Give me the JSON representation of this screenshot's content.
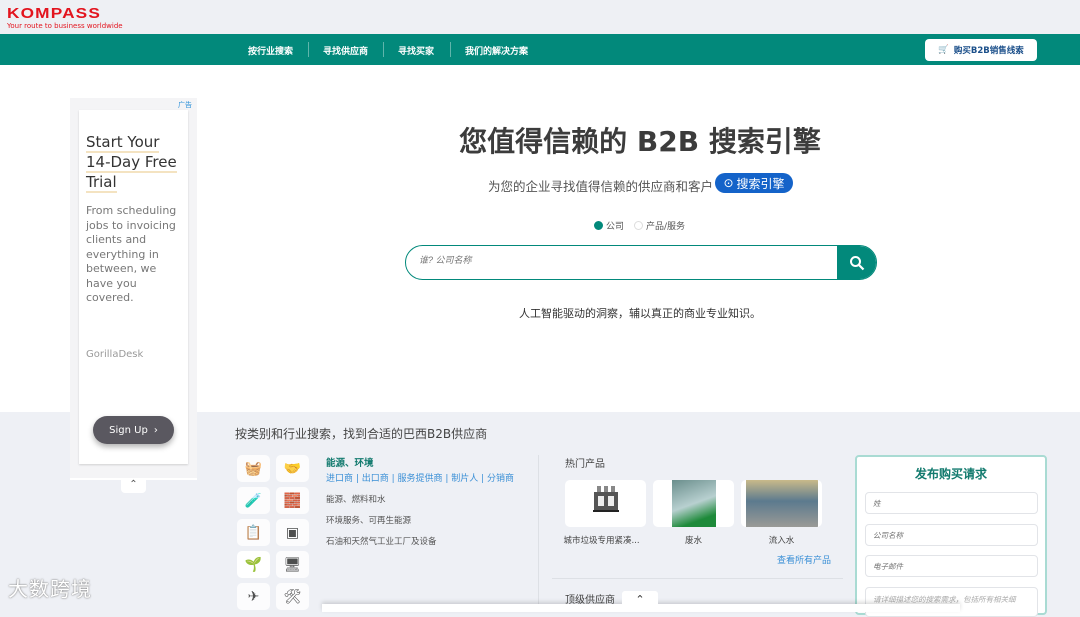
{
  "header": {
    "logo": "KOMPASS",
    "tagline": "Your route to business worldwide",
    "nav": [
      "按行业搜索",
      "寻找供应商",
      "寻找买家",
      "我们的解决方案"
    ],
    "buy_button": "购买B2B销售线索"
  },
  "hero": {
    "title": "您值得信赖的 B2B 搜索引擎",
    "subtitle": "为您的企业寻找值得信赖的供应商和客户",
    "pill": "搜索引擎",
    "radio_company": "公司",
    "radio_product": "产品/服务",
    "search_placeholder": "谁? 公司名称",
    "tagline": "人工智能驱动的洞察，辅以真正的商业专业知识。"
  },
  "ad": {
    "label": "广告",
    "title_lines": [
      "Start Your",
      "14-Day Free",
      "Trial"
    ],
    "body": "From scheduling jobs to invoicing clients and everything in between, we have you covered.",
    "brand": "GorillaDesk",
    "cta": "Sign Up"
  },
  "lower": {
    "heading": "按类别和行业搜索，找到合适的巴西B2B供应商",
    "category": {
      "title": "能源、环境",
      "links": "进口商 | 出口商 | 服务提供商 | 制片人 | 分销商",
      "items": [
        "能源、燃料和水",
        "环境服务、可再生能源",
        "石油和天然气工业工厂及设备"
      ]
    },
    "hot_title": "热门产品",
    "products": [
      "城市垃圾专用紧凑...",
      "废水",
      "流入水"
    ],
    "view_all": "查看所有产品",
    "top_suppliers": "顶级供应商"
  },
  "form": {
    "title": "发布购买请求",
    "last_name": "姓",
    "company": "公司名称",
    "email": "电子邮件",
    "desc": "请详细描述您的搜索需求，包括所有相关细"
  },
  "watermark": "大数跨境",
  "colors": {
    "teal": "#02897b",
    "blue": "#1463c9",
    "red": "#e3141e"
  }
}
